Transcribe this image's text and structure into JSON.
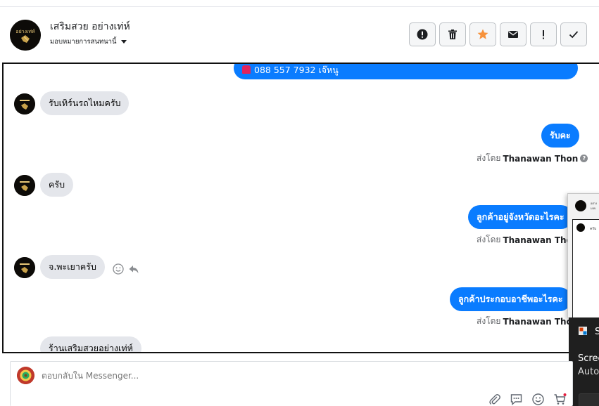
{
  "header": {
    "page_name": "เสริมสวย อย่างเท่ห์",
    "assign_label": "มอบหมายการสนทนานี้",
    "avatar_text": "อย่างเท่ห์"
  },
  "toolbar": {
    "buttons": [
      {
        "icon": "alert-circle-icon",
        "label": "!"
      },
      {
        "icon": "trash-icon",
        "label": ""
      },
      {
        "icon": "star-icon",
        "label": ""
      },
      {
        "icon": "envelope-icon",
        "label": ""
      },
      {
        "icon": "exclamation-icon",
        "label": "!"
      },
      {
        "icon": "checkmark-icon",
        "label": "✓"
      }
    ],
    "star_color": "#f7923b"
  },
  "thread": {
    "pinned": {
      "icon": "siren-icon",
      "text": "088 557 7932 เจ๊หนู"
    },
    "messages": [
      {
        "direction": "in",
        "text": "รับเทิร์นรถไหมครับ"
      },
      {
        "direction": "out",
        "text": "รับคะ",
        "sent_by_label": "ส่งโดย",
        "sender": "Thanawan Thon"
      },
      {
        "direction": "in",
        "text": "ครับ"
      },
      {
        "direction": "out",
        "text": "ลูกค้าอยู่จังหวัดอะไรคะ",
        "sent_by_label": "ส่งโดย",
        "sender": "Thanawan Thon"
      },
      {
        "direction": "in",
        "text": "จ.พะเยาครับ"
      },
      {
        "direction": "out",
        "text": "ลูกค้าประกอบอาชีพอะไรคะ",
        "sent_by_label": "ส่งโดย",
        "sender": "Thanawan Thon"
      },
      {
        "direction": "in",
        "text": "ร้านเสริมสวยอย่างเท่ห์"
      }
    ],
    "bubble_out_color": "#0a7cff",
    "bubble_in_color": "#e4e6eb"
  },
  "overlay_windows": {
    "popup_line": "ครับ",
    "notification": {
      "title": "S",
      "line1": "Scree",
      "line2": "Auto"
    }
  },
  "reply": {
    "placeholder": "ตอบกลับใน Messenger...",
    "tools": [
      "paperclip-icon",
      "saved-reply-icon",
      "emoji-icon",
      "cart-icon"
    ]
  }
}
